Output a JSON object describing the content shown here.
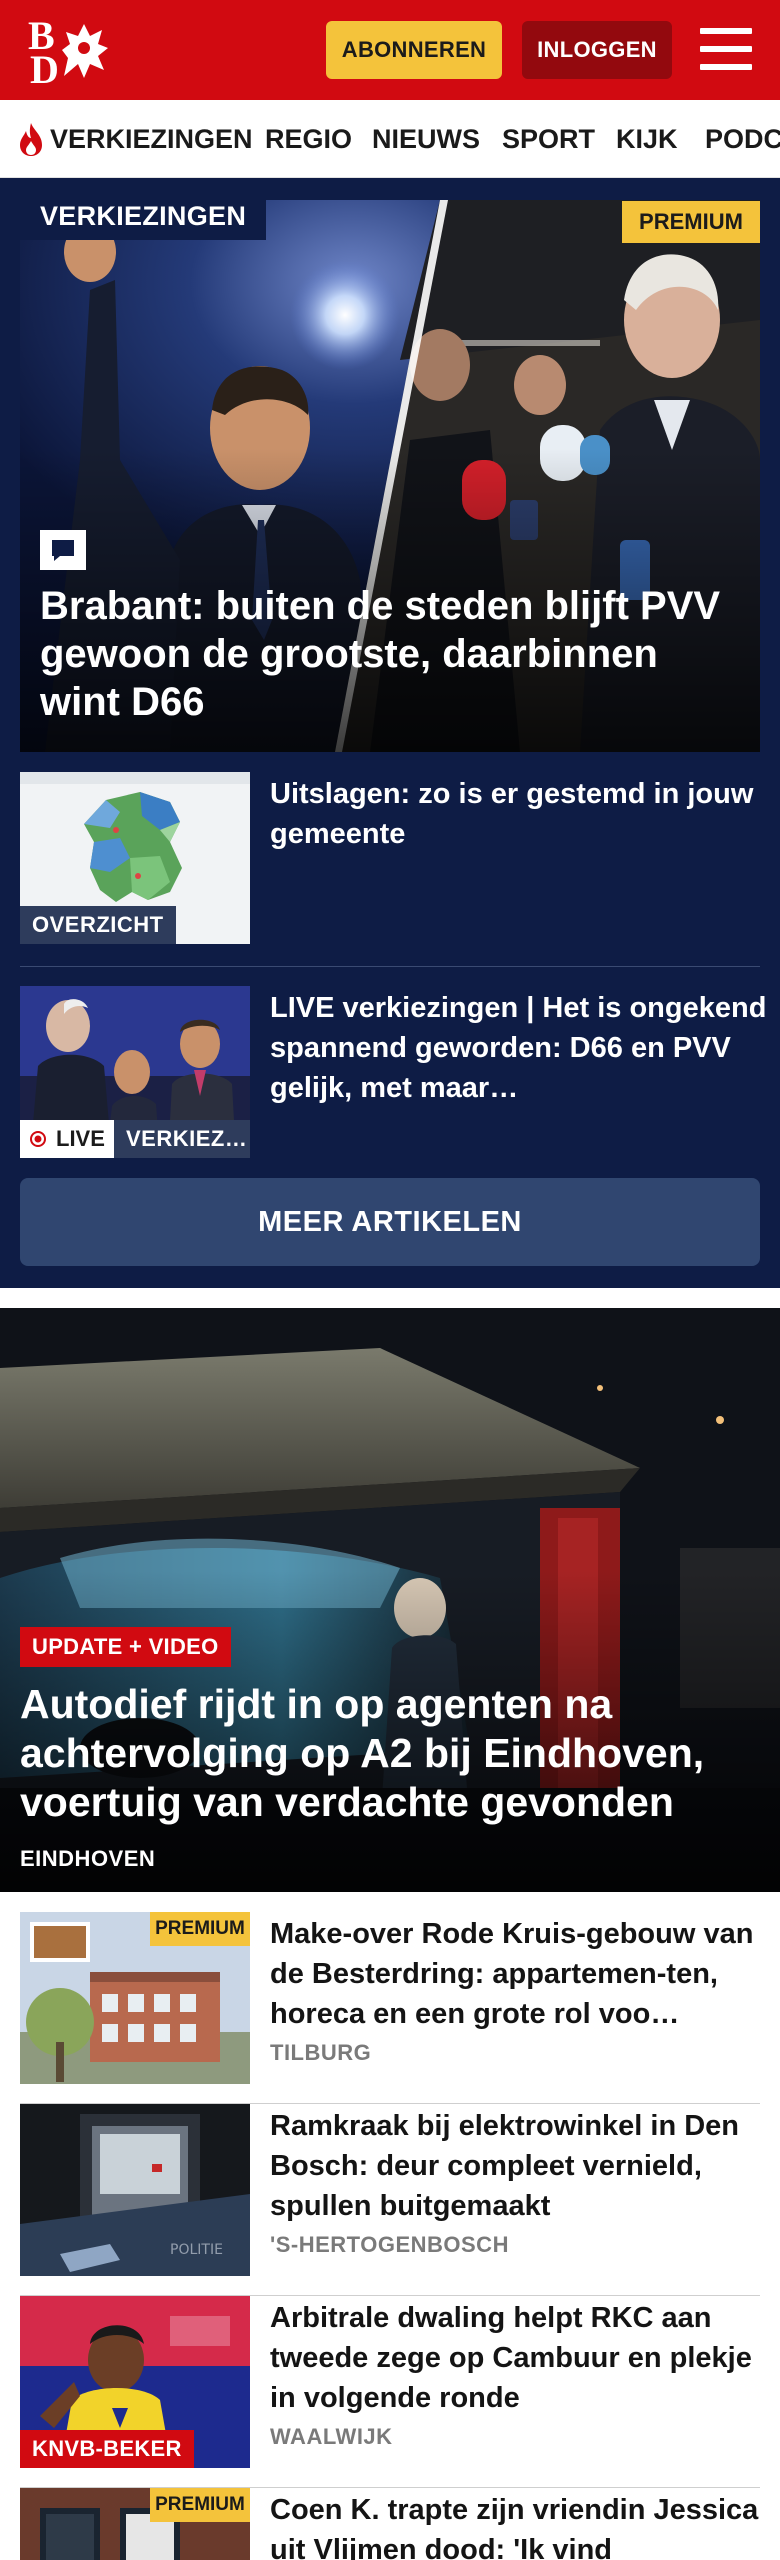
{
  "header": {
    "logo_top": "B",
    "logo_bottom": "D",
    "subscribe_label": "ABONNEREN",
    "login_label": "INLOGGEN",
    "brand_color": "#d10a11"
  },
  "nav": {
    "items": [
      "VERKIEZINGEN",
      "REGIO",
      "NIEUWS",
      "SPORT",
      "KIJK",
      "PODC"
    ]
  },
  "election": {
    "section_label": "VERKIEZINGEN",
    "hero": {
      "badge": "PREMIUM",
      "title": "Brabant: buiten de steden blijft PVV gewoon de grootste, daarbinnen wint D66"
    },
    "cards": [
      {
        "title": "Uitslagen: zo is er gestemd in jouw gemeente",
        "label": "OVERZICHT"
      },
      {
        "title": "LIVE verkiezingen | Het is ongekend spannend geworden: D66 en PVV gelijk, met maar…",
        "live_label": "LIVE",
        "label": "VERKIEZ…"
      }
    ],
    "more_label": "MEER ARTIKELEN"
  },
  "feature": {
    "badge": "UPDATE + VIDEO",
    "title": "Autodief rijdt in op agenten na achtervolging op A2 bij Eindhoven, voertuig van verdachte gevonden",
    "location": "EINDHOVEN"
  },
  "list": [
    {
      "badge": "PREMIUM",
      "title": "Make-over Rode Kruis-gebouw van de Besterdring: appartemen-ten, horeca en een grote rol voo…",
      "location": "TILBURG"
    },
    {
      "title": "Ramkraak bij elektrowinkel in Den Bosch: deur compleet vernield, spullen buitgemaakt",
      "location": "'S-HERTOGENBOSCH"
    },
    {
      "badge": "KNVB-BEKER",
      "title": "Arbitrale dwaling helpt RKC aan tweede zege op Cambuur en plekje in volgende ronde",
      "location": "WAALWIJK"
    },
    {
      "badge": "PREMIUM",
      "title": "Coen K. trapte zijn vriendin Jessica uit Vlijmen dood: 'Ik vind"
    }
  ]
}
